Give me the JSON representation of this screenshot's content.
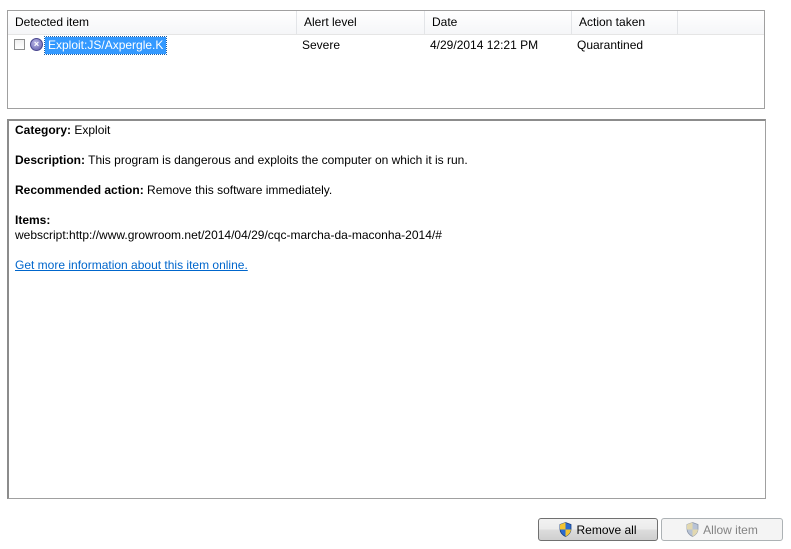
{
  "list": {
    "columns": [
      "Detected item",
      "Alert level",
      "Date",
      "Action taken"
    ],
    "rows": [
      {
        "checked": false,
        "icon": "threat-x-icon",
        "name": "Exploit:JS/Axpergle.K",
        "alert_level": "Severe",
        "date": "4/29/2014 12:21 PM",
        "action": "Quarantined"
      }
    ]
  },
  "details": {
    "category_label": "Category:",
    "category_value": "Exploit",
    "description_label": "Description:",
    "description_value": "This program is dangerous and exploits the computer on which it is run.",
    "recommended_label": "Recommended action:",
    "recommended_value": "Remove this software immediately.",
    "items_label": "Items:",
    "items_value": "webscript:http://www.growroom.net/2014/04/29/cqc-marcha-da-maconha-2014/#",
    "more_info_link": "Get more information about this item online."
  },
  "buttons": {
    "remove_all": "Remove all",
    "allow_item": "Allow item"
  },
  "colors": {
    "selection": "#3399ff",
    "link": "#0066cc"
  }
}
